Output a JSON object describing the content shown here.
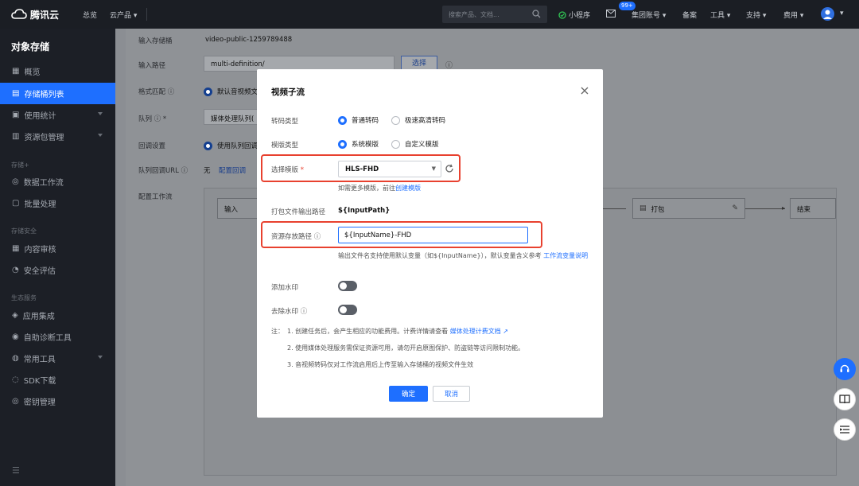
{
  "topbar": {
    "logo": "腾讯云",
    "overview": "总览",
    "products": "云产品",
    "search_placeholder": "搜索产品、文档...",
    "mini_program": "小程序",
    "msg_badge": "99+",
    "account": "集团账号",
    "filing": "备案",
    "tools": "工具",
    "support": "支持",
    "billing": "费用"
  },
  "sidebar": {
    "title": "对象存储",
    "items": [
      {
        "label": "概览"
      },
      {
        "label": "存储桶列表"
      },
      {
        "label": "使用统计"
      },
      {
        "label": "资源包管理"
      }
    ],
    "sec_storage": "存储+",
    "storage_items": [
      {
        "label": "数据工作流"
      },
      {
        "label": "批量处理"
      }
    ],
    "sec_security": "存储安全",
    "security_items": [
      {
        "label": "内容审核"
      },
      {
        "label": "安全评估"
      }
    ],
    "sec_ecosystem": "生态服务",
    "eco_items": [
      {
        "label": "应用集成"
      },
      {
        "label": "自助诊断工具"
      },
      {
        "label": "常用工具"
      },
      {
        "label": "SDK下载"
      },
      {
        "label": "密钥管理"
      }
    ]
  },
  "background_form": {
    "input_bucket_label": "输入存储桶",
    "input_bucket_value": "video-public-1259789488",
    "input_path_label": "输入路径",
    "input_path_value": "multi-definition/",
    "select_btn": "选择",
    "format_label": "格式匹配",
    "format_value": "默认音视频文",
    "queue_label": "队列",
    "queue_value": "媒体处理队列(",
    "callback_label": "回调设置",
    "callback_value": "使用队列回调",
    "queue_callback_url_label": "队列回调URL",
    "queue_callback_url_value": "无",
    "config_callback": "配置回调",
    "workflow_label": "配置工作流",
    "node_input": "输入",
    "node_pack": "打包",
    "node_end": "结束"
  },
  "dialog": {
    "title": "视频子流",
    "transcode_type_label": "转码类型",
    "transcode_opt1": "普通转码",
    "transcode_opt2": "极速高清转码",
    "template_type_label": "模版类型",
    "template_opt1": "系统模版",
    "template_opt2": "自定义模版",
    "select_template_label": "选择模版",
    "required_mark": "*",
    "template_value": "HLS-FHD",
    "more_templates_hint": "如需更多模版，前往",
    "create_template_link": "创建模版",
    "pack_output_path_label": "打包文件输出路径",
    "pack_output_path_value": "${InputPath}",
    "resource_path_label": "资源存放路径",
    "resource_path_value": "${InputName}-FHD",
    "resource_hint": "输出文件名支持使用默认变量（如${InputName}），默认变量含义参考",
    "resource_hint_link": "工作流变量说明",
    "add_watermark_label": "添加水印",
    "remove_watermark_label": "去除水印",
    "note_prefix": "注：",
    "note1": "1. 创建任务后，会产生相应的功能费用。计费详情请查看",
    "note1_link": "媒体处理计费文档",
    "note2": "2. 使用媒体处理服务需保证资源可用，请勿开启原图保护、防盗链等访问限制功能。",
    "note3": "3. 音视频转码仅对工作流启用后上传至输入存储桶的视频文件生效",
    "confirm": "确定",
    "cancel": "取消"
  },
  "colors": {
    "accent": "#1e6fff",
    "highlight": "#e8412f",
    "topbar": "#1b1e24",
    "sidebar": "#1c1f26"
  }
}
